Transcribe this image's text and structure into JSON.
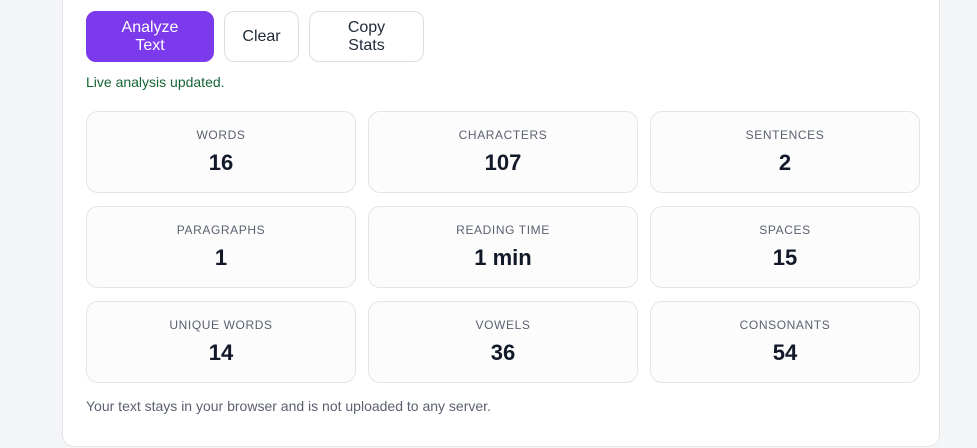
{
  "actions": {
    "analyze_label": "Analyze Text",
    "clear_label": "Clear",
    "copy_label": "Copy Stats"
  },
  "status": "Live analysis updated.",
  "stats": [
    {
      "label": "WORDS",
      "value": "16"
    },
    {
      "label": "CHARACTERS",
      "value": "107"
    },
    {
      "label": "SENTENCES",
      "value": "2"
    },
    {
      "label": "PARAGRAPHS",
      "value": "1"
    },
    {
      "label": "READING TIME",
      "value": "1 min"
    },
    {
      "label": "SPACES",
      "value": "15"
    },
    {
      "label": "UNIQUE WORDS",
      "value": "14"
    },
    {
      "label": "VOWELS",
      "value": "36"
    },
    {
      "label": "CONSONANTS",
      "value": "54"
    }
  ],
  "footnote": "Your text stays in your browser and is not uploaded to any server.",
  "colors": {
    "accent": "#7c3aed",
    "status": "#166534"
  }
}
